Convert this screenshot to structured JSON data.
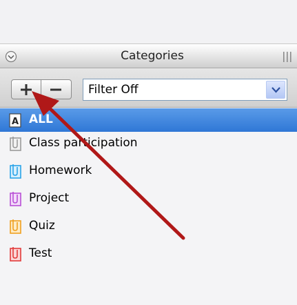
{
  "panel": {
    "title": "Categories",
    "filter": {
      "selected": "Filter Off"
    },
    "buttons": {
      "add": "+",
      "remove": "−"
    }
  },
  "categories": [
    {
      "label": "ALL",
      "icon": "all-icon",
      "color": "#ffffff",
      "selected": true
    },
    {
      "label": "Class participation",
      "icon": "category-icon-gray",
      "color": "#9a9a9a",
      "selected": false
    },
    {
      "label": "Homework",
      "icon": "category-icon-blue",
      "color": "#29a3e8",
      "selected": false
    },
    {
      "label": "Project",
      "icon": "category-icon-purple",
      "color": "#b84fd6",
      "selected": false
    },
    {
      "label": "Quiz",
      "icon": "category-icon-orange",
      "color": "#f0a020",
      "selected": false
    },
    {
      "label": "Test",
      "icon": "category-icon-red",
      "color": "#e23a3a",
      "selected": false
    }
  ],
  "annotation": {
    "arrow_color": "#b01818",
    "points_to": "add-category-button"
  }
}
